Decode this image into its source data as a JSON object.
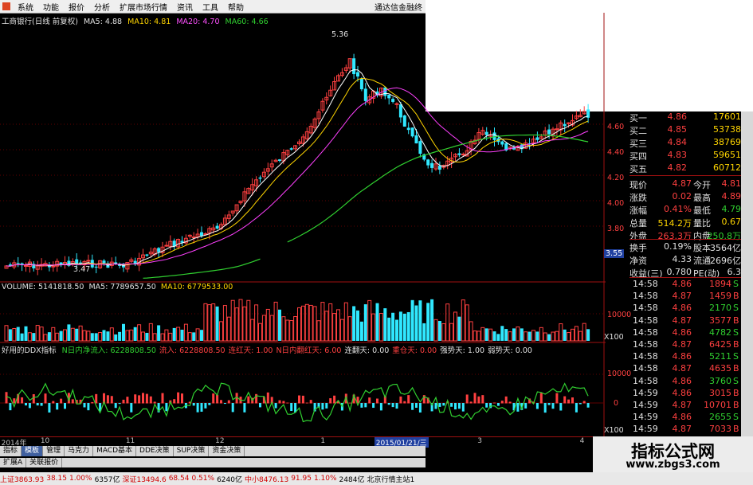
{
  "menu": {
    "items": [
      "系统",
      "功能",
      "报价",
      "分析",
      "扩展市场行情",
      "资讯",
      "工具",
      "帮助"
    ],
    "brand": "通达信金融终"
  },
  "price_panel": {
    "title": "工商银行(日线 前复权)",
    "ma5_label": "MA5: 4.88",
    "ma10_label": "MA10: 4.81",
    "ma20_label": "MA20: 4.70",
    "ma60_label": "MA60: 4.66",
    "high_label": "5.36",
    "low_label": "3.47",
    "yticks": [
      "4.60",
      "4.40",
      "4.20",
      "4.00",
      "3.80"
    ],
    "current_tag": "3.55"
  },
  "volume_panel": {
    "title": "VOLUME: 5141818.50",
    "ma5": "MA5: 7789657.50",
    "ma10": "MA10: 6779533.00",
    "ytick": "10000",
    "unit": "X100"
  },
  "ddx_panel": {
    "title": "好用的DDX指标",
    "items": [
      {
        "text": "N日内净流入: 6228808.50",
        "color": "#30d030"
      },
      {
        "text": "流入: 6228808.50",
        "color": "#ff4040"
      },
      {
        "text": "连红天: 1.00",
        "color": "#ff4040"
      },
      {
        "text": "N日内翻红天: 6.00",
        "color": "#ff4040"
      },
      {
        "text": "连翻天: 0.00",
        "color": "#e0e0e0"
      },
      {
        "text": "重仓天: 0.00",
        "color": "#ff4040"
      },
      {
        "text": "强势天: 1.00",
        "color": "#e0e0e0"
      },
      {
        "text": "弱势天: 0.00",
        "color": "#e0e0e0"
      }
    ],
    "ytick_top": "10000",
    "ytick_mid": "0",
    "unit": "X100"
  },
  "time_axis": {
    "labels": [
      {
        "text": "2014年",
        "pos": 0.003
      },
      {
        "text": "10",
        "pos": 0.095
      },
      {
        "text": "11",
        "pos": 0.295
      },
      {
        "text": "12",
        "pos": 0.505
      },
      {
        "text": "1",
        "pos": 0.752
      },
      {
        "text": "2015/01/21/三",
        "pos": 0.878,
        "highlight": true
      },
      {
        "text": "3",
        "pos": 1.12
      },
      {
        "text": "4",
        "pos": 1.36
      }
    ]
  },
  "quote": {
    "bids": [
      {
        "label": "买一",
        "price": "4.86",
        "vol": "17601"
      },
      {
        "label": "买二",
        "price": "4.85",
        "vol": "53738"
      },
      {
        "label": "买三",
        "price": "4.84",
        "vol": "38769"
      },
      {
        "label": "买四",
        "price": "4.83",
        "vol": "59651"
      },
      {
        "label": "买五",
        "price": "4.82",
        "vol": "60712"
      }
    ],
    "stats": [
      {
        "l1": "现价",
        "v1": "4.87",
        "c1": "red",
        "l2": "今开",
        "v2": "4.81",
        "c2": "red"
      },
      {
        "l1": "涨跌",
        "v1": "0.02",
        "c1": "red",
        "l2": "最高",
        "v2": "4.89",
        "c2": "red"
      },
      {
        "l1": "涨幅",
        "v1": "0.41%",
        "c1": "red",
        "l2": "最低",
        "v2": "4.79",
        "c2": "grn"
      },
      {
        "l1": "总量",
        "v1": "514.2万",
        "c1": "yel",
        "l2": "量比",
        "v2": "0.67",
        "c2": "yel"
      },
      {
        "l1": "外盘",
        "v1": "263.3万",
        "c1": "red",
        "l2": "内盘",
        "v2": "250.8万",
        "c2": "grn"
      }
    ],
    "stats2": [
      {
        "l1": "换手",
        "v1": "0.19%",
        "l2": "股本",
        "v2": "3564亿"
      },
      {
        "l1": "净资",
        "v1": "4.33",
        "l2": "流通",
        "v2": "2696亿"
      },
      {
        "l1": "收益(三)",
        "v1": "0.780",
        "l2": "PE(动)",
        "v2": "6.3"
      }
    ],
    "ticks": [
      {
        "t": "14:58",
        "p": "4.86",
        "v": "1894",
        "s": "S",
        "pc": "red",
        "vc": "red"
      },
      {
        "t": "14:58",
        "p": "4.87",
        "v": "1459",
        "s": "B",
        "pc": "red",
        "vc": "red"
      },
      {
        "t": "14:58",
        "p": "4.86",
        "v": "2170",
        "s": "S",
        "pc": "red",
        "vc": "grn"
      },
      {
        "t": "14:58",
        "p": "4.87",
        "v": "3577",
        "s": "B",
        "pc": "red",
        "vc": "red"
      },
      {
        "t": "14:58",
        "p": "4.86",
        "v": "4782",
        "s": "S",
        "pc": "red",
        "vc": "grn"
      },
      {
        "t": "14:58",
        "p": "4.87",
        "v": "6425",
        "s": "B",
        "pc": "red",
        "vc": "red"
      },
      {
        "t": "14:58",
        "p": "4.86",
        "v": "5211",
        "s": "S",
        "pc": "red",
        "vc": "grn"
      },
      {
        "t": "14:58",
        "p": "4.87",
        "v": "4635",
        "s": "B",
        "pc": "red",
        "vc": "red"
      },
      {
        "t": "14:58",
        "p": "4.86",
        "v": "3760",
        "s": "S",
        "pc": "red",
        "vc": "grn"
      },
      {
        "t": "14:59",
        "p": "4.86",
        "v": "3015",
        "s": "B",
        "pc": "red",
        "vc": "red"
      },
      {
        "t": "14:59",
        "p": "4.87",
        "v": "10701",
        "s": "B",
        "pc": "red",
        "vc": "red"
      },
      {
        "t": "14:59",
        "p": "4.86",
        "v": "2655",
        "s": "S",
        "pc": "red",
        "vc": "grn"
      },
      {
        "t": "14:59",
        "p": "4.87",
        "v": "7033",
        "s": "B",
        "pc": "red",
        "vc": "red"
      }
    ],
    "yticks": [
      "4.60",
      "4.40",
      "4.20",
      "4.00",
      "3.80"
    ]
  },
  "tabs": [
    "指标",
    "模板",
    "管理",
    "马克力",
    "MACD基本",
    "DDE决策",
    "SUP决策",
    "资金决策"
  ],
  "tabs2": [
    "扩展A",
    "关联报价"
  ],
  "status": [
    {
      "text": "上证3863.93",
      "c": "red"
    },
    {
      "text": "38.15",
      "c": "red"
    },
    {
      "text": "1.00%",
      "c": "red"
    },
    {
      "text": "6357亿",
      "c": "blk"
    },
    {
      "text": "深证13494.6",
      "c": "red"
    },
    {
      "text": "68.54",
      "c": "red"
    },
    {
      "text": "0.51%",
      "c": "red"
    },
    {
      "text": "6240亿",
      "c": "blk"
    },
    {
      "text": "中小8476.13",
      "c": "red"
    },
    {
      "text": "91.95",
      "c": "red"
    },
    {
      "text": "1.10%",
      "c": "red"
    },
    {
      "text": "2484亿",
      "c": "blk"
    },
    {
      "text": "北京行情主站1",
      "c": "blk"
    }
  ],
  "watermark": {
    "line1": "指标公式网",
    "line2": "www.zbgs3.com"
  },
  "colors": {
    "up": "#ff4040",
    "down": "#30e8ff",
    "ma5": "#ffffff",
    "ma10": "#ffd500",
    "ma20": "#ff40ff",
    "ma60": "#30d030",
    "bg": "#000000",
    "grid": "#a01010"
  }
}
